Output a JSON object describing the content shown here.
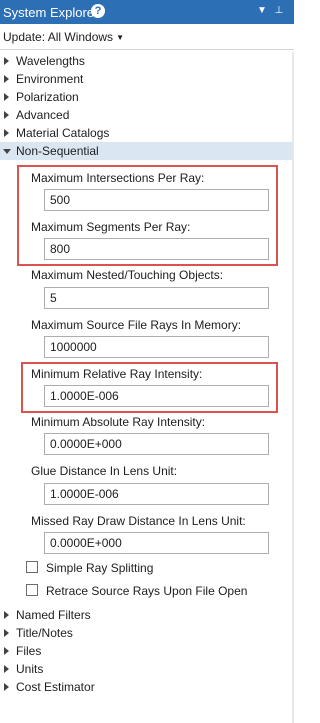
{
  "window": {
    "title": "System Explorer",
    "accent": "#2d6fb5"
  },
  "toolbar": {
    "update_label": "Update: All Windows"
  },
  "tree": {
    "items_before": [
      {
        "label": "Wavelengths"
      },
      {
        "label": "Environment"
      },
      {
        "label": "Polarization"
      },
      {
        "label": "Advanced"
      },
      {
        "label": "Material Catalogs"
      }
    ],
    "expanded": {
      "label": "Non-Sequential"
    },
    "items_after": [
      {
        "label": "Named Filters"
      },
      {
        "label": "Title/Notes"
      },
      {
        "label": "Files"
      },
      {
        "label": "Units"
      },
      {
        "label": "Cost Estimator"
      }
    ]
  },
  "non_sequential": {
    "fields": [
      {
        "label": "Maximum Intersections Per Ray:",
        "value": "500"
      },
      {
        "label": "Maximum Segments Per Ray:",
        "value": "800"
      },
      {
        "label": "Maximum Nested/Touching Objects:",
        "value": "5"
      },
      {
        "label": "Maximum Source File Rays In Memory:",
        "value": "1000000"
      },
      {
        "label": "Minimum Relative Ray Intensity:",
        "value": "1.0000E-006"
      },
      {
        "label": "Minimum Absolute Ray Intensity:",
        "value": "0.0000E+000"
      },
      {
        "label": "Glue Distance In Lens Unit:",
        "value": "1.0000E-006"
      },
      {
        "label": "Missed Ray Draw Distance In Lens Unit:",
        "value": "0.0000E+000"
      }
    ],
    "checkboxes": [
      {
        "label": "Simple Ray Splitting",
        "checked": false
      },
      {
        "label": "Retrace Source Rays Upon File Open",
        "checked": false
      }
    ],
    "highlight_color": "#d9534f"
  }
}
